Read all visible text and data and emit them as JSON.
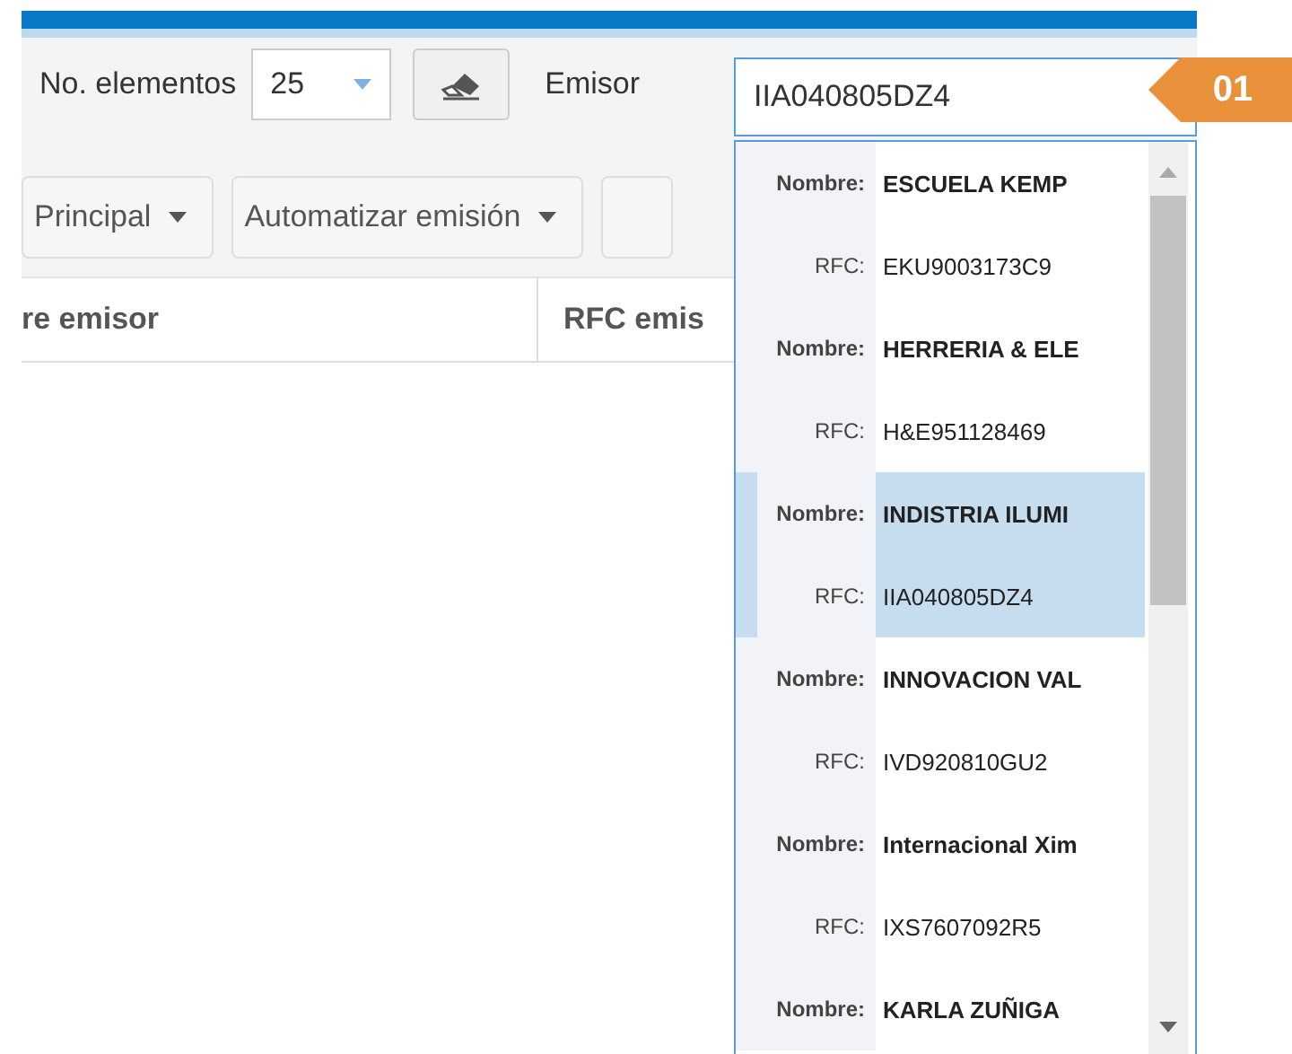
{
  "toolbar": {
    "page_size_label": "No. elementos",
    "page_size": "25",
    "issuer_label": "Emisor",
    "issuer_value": "IIA040805DZ4"
  },
  "actions": [
    {
      "label": "Principal"
    },
    {
      "label": "Automatizar emisión"
    }
  ],
  "table": {
    "columns": [
      "re emisor",
      "RFC emis"
    ]
  },
  "dropdown": {
    "items": [
      {
        "name_label": "Nombre:",
        "name": "ESCUELA KEMP",
        "rfc_label": "RFC:",
        "rfc": "EKU9003173C9",
        "selected": false
      },
      {
        "name_label": "Nombre:",
        "name": "HERRERIA & ELE",
        "rfc_label": "RFC:",
        "rfc": "H&E951128469",
        "selected": false
      },
      {
        "name_label": "Nombre:",
        "name": "INDISTRIA ILUMI",
        "rfc_label": "RFC:",
        "rfc": "IIA040805DZ4",
        "selected": true
      },
      {
        "name_label": "Nombre:",
        "name": "INNOVACION VAL",
        "rfc_label": "RFC:",
        "rfc": "IVD920810GU2",
        "selected": false
      },
      {
        "name_label": "Nombre:",
        "name": "Internacional Xim",
        "rfc_label": "RFC:",
        "rfc": "IXS7607092R5",
        "selected": false
      },
      {
        "name_label": "Nombre:",
        "name": "KARLA ZUÑIGA",
        "selected": false
      }
    ]
  },
  "callout": {
    "label": "01"
  }
}
